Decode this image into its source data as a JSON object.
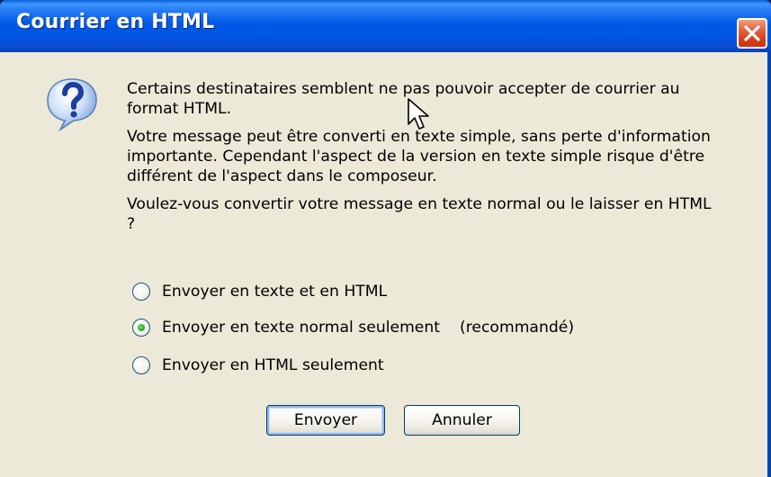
{
  "window": {
    "title": "Courrier en HTML"
  },
  "message": {
    "paragraphs": [
      "Certains destinataires semblent ne pas pouvoir accepter de courrier au format HTML.",
      "Votre message peut être converti en texte simple, sans perte d'information importante. Cependant l'aspect de la version en texte simple risque d'être différent de l'aspect dans le composeur.",
      "Voulez-vous convertir votre message en texte normal ou le laisser en HTML ?"
    ]
  },
  "options": [
    {
      "label": "Envoyer en texte et en HTML",
      "note": "",
      "checked": false
    },
    {
      "label": "Envoyer en texte normal seulement",
      "note": "(recommandé)",
      "checked": true
    },
    {
      "label": "Envoyer en HTML seulement",
      "note": "",
      "checked": false
    }
  ],
  "buttons": {
    "send": "Envoyer",
    "cancel": "Annuler"
  },
  "icons": {
    "dialog": "question-icon",
    "close": "close-icon"
  },
  "colors": {
    "titlebar": "#0058e6",
    "background": "#ece9d8",
    "close_button": "#d43f16",
    "radio_checked": "#2aa52a"
  }
}
